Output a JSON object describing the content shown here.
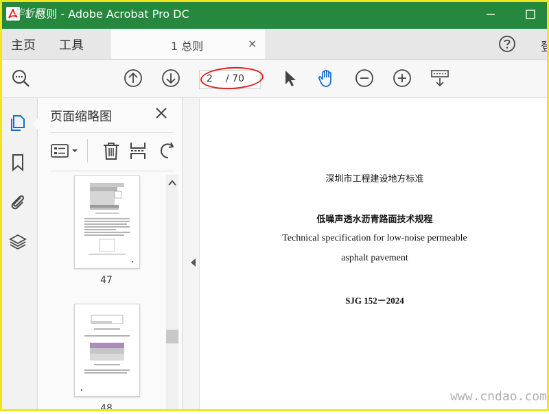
{
  "window": {
    "title": "1 总则 - Adobe Acrobat Pro DC",
    "watermark_text": "毕析网",
    "accent_color": "#25883e",
    "frame_color": "#f1e51c"
  },
  "tabs": {
    "home_label": "主页",
    "tools_label": "工具",
    "document_tab_label": "1 总则",
    "close_glyph": "×",
    "signin_partial": "登"
  },
  "toolbar": {
    "current_page": "2",
    "total_pages": "/ 70",
    "icons": [
      "search-icon",
      "page-up-icon",
      "page-down-icon",
      "select-cursor-icon",
      "hand-tool-icon",
      "zoom-out-icon",
      "zoom-in-icon",
      "keyboard-scroll-icon"
    ],
    "annotation_color": "#e0201b"
  },
  "rail": {
    "icons": [
      "page-thumbnails-icon",
      "bookmarks-icon",
      "attachments-icon",
      "layers-icon"
    ]
  },
  "panel": {
    "title": "页面缩略图",
    "thumbnails": [
      {
        "label": "47"
      },
      {
        "label": "48"
      }
    ]
  },
  "document": {
    "line1": "深圳市工程建设地方标准",
    "line2": "低噪声透水沥青路面技术规程",
    "line3": "Technical specification for low-noise permeable",
    "line4": "asphalt pavement",
    "line5": "SJG 152－2024"
  },
  "site_watermark": "www.cndao.com"
}
